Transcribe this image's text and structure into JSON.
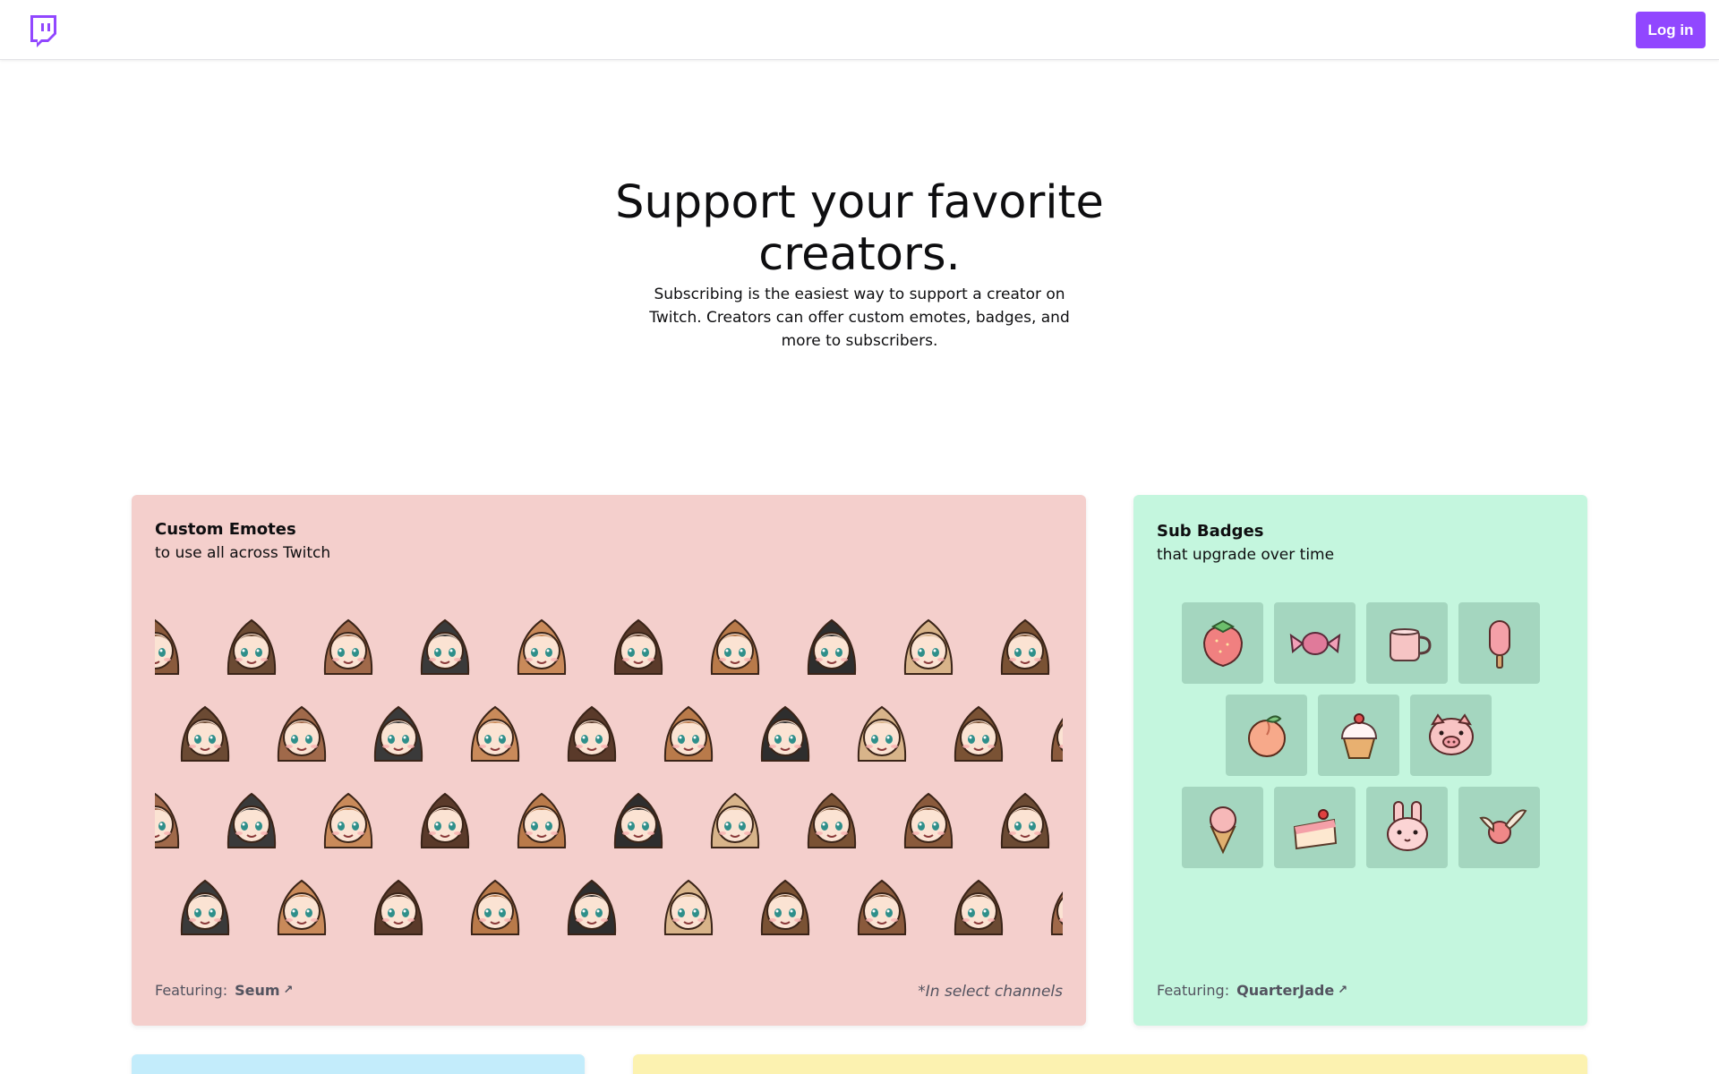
{
  "nav": {
    "logo_icon": "twitch-logo-icon",
    "login_label": "Log in",
    "accent_color": "#9147ff"
  },
  "hero": {
    "title": "Support your favorite creators.",
    "subtitle": "Subscribing is the easiest way to support a creator on Twitch. Creators can offer custom emotes, badges, and more to subscribers."
  },
  "emotes_card": {
    "title": "Custom Emotes",
    "subtitle": "to use all across Twitch",
    "featuring_label": "Featuring:",
    "featuring_name": "Seum",
    "featuring_arrow": "↗",
    "note": "*In select channels",
    "background": "#f4cfcc"
  },
  "badges_card": {
    "title": "Sub Badges",
    "subtitle": "that upgrade over time",
    "featuring_label": "Featuring:",
    "featuring_name": "QuarterJade",
    "featuring_arrow": "↗",
    "background": "#c4f6de",
    "badges": [
      "strawberry-icon",
      "candy-icon",
      "mug-icon",
      "popsicle-icon",
      "peach-icon",
      "cupcake-icon",
      "pig-icon",
      "ice-cream-icon",
      "cake-slice-icon",
      "bunny-icon",
      "winged-orb-icon"
    ]
  },
  "lower_cards": {
    "blue_background": "#c3ecfb",
    "yellow_background": "#fcf2b0"
  }
}
